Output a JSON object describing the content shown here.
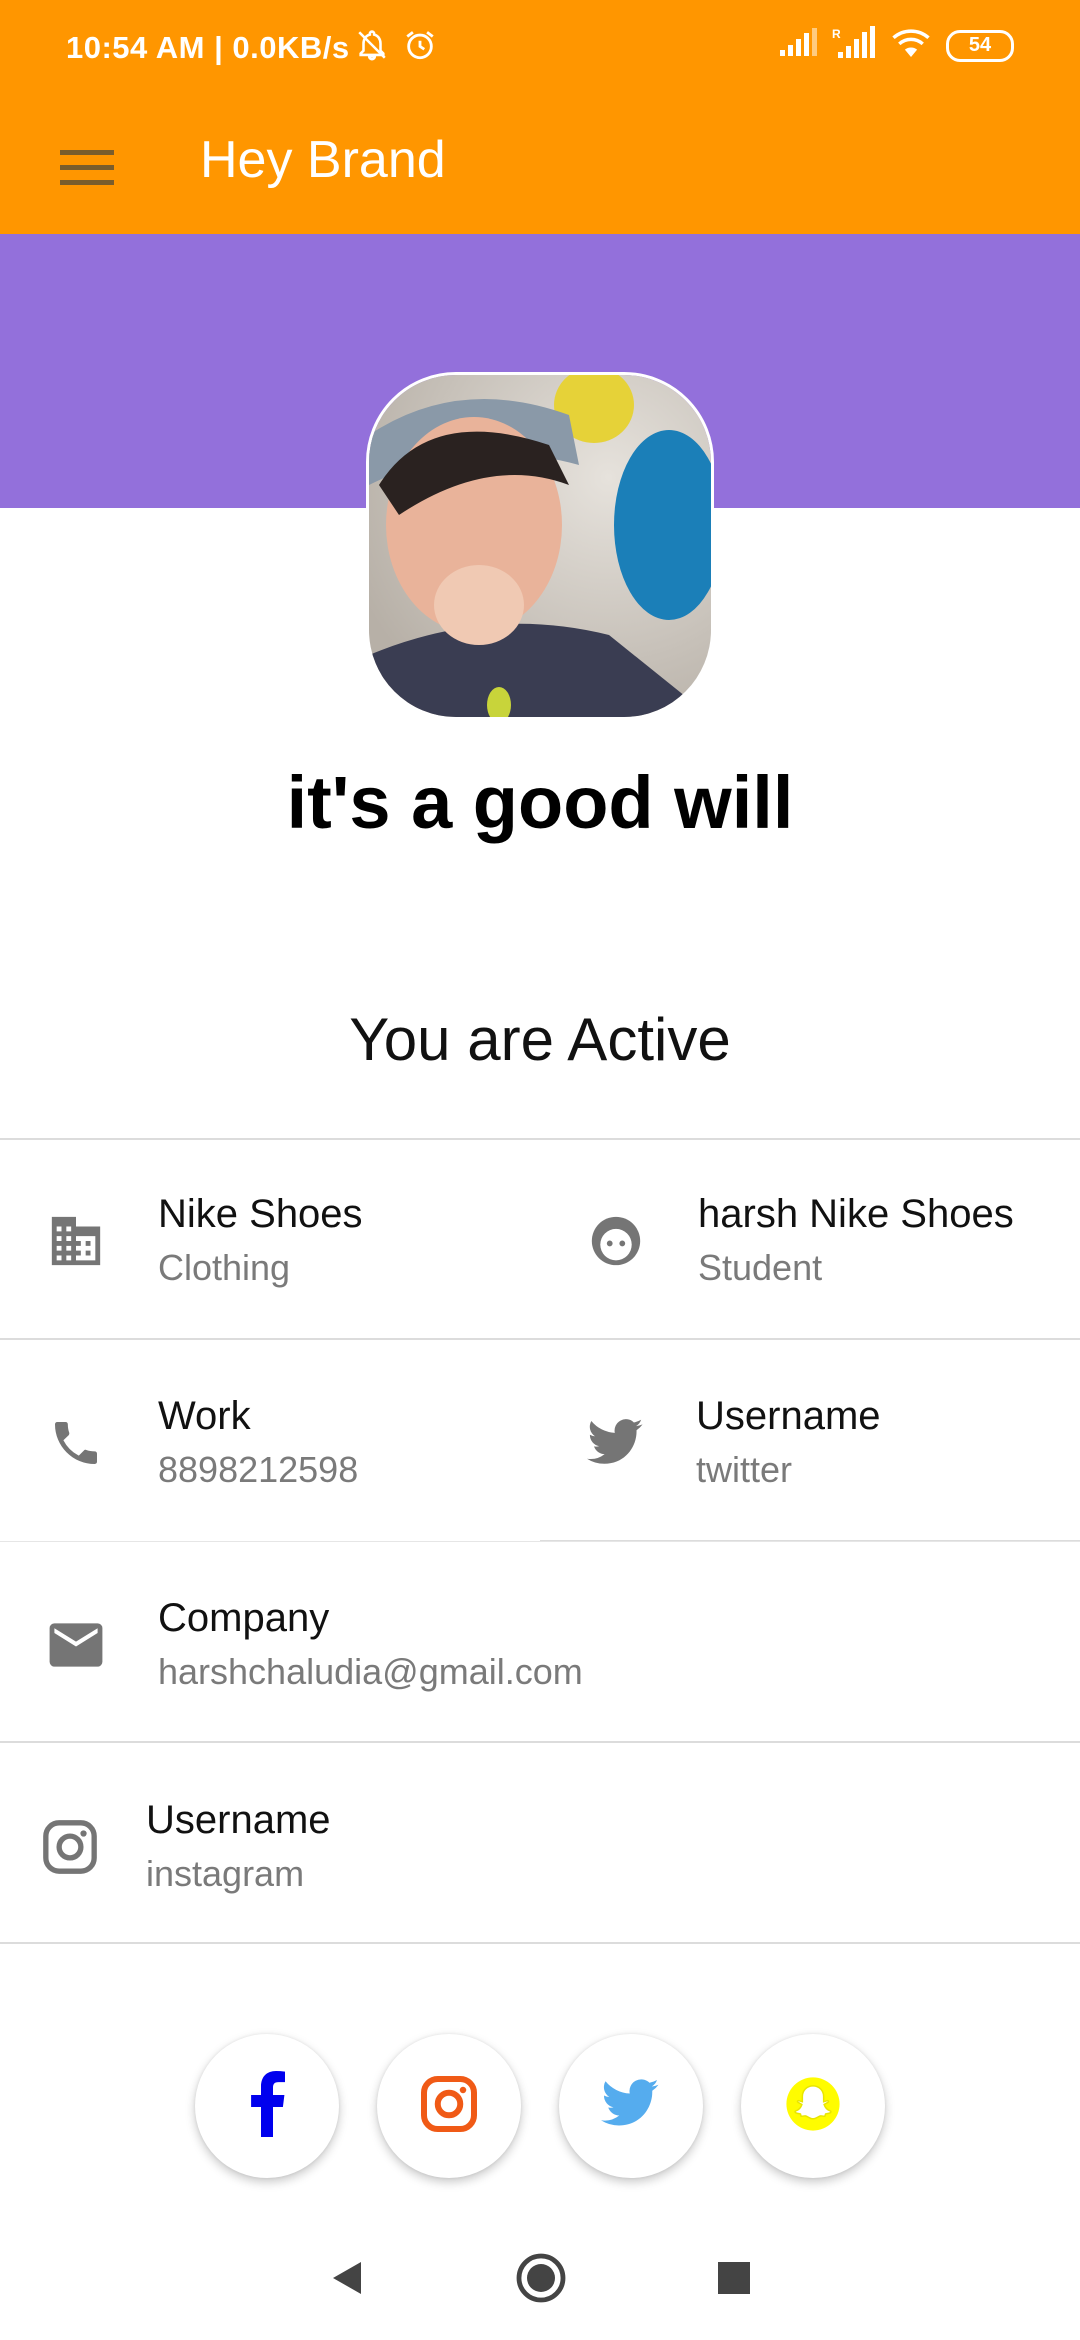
{
  "status_bar": {
    "time": "10:54 AM | 0.0KB/s",
    "battery": "54",
    "icons": [
      "bell-off-icon",
      "alarm-icon",
      "signal-icon",
      "signal-roaming-icon",
      "wifi-icon",
      "battery-icon"
    ]
  },
  "app_bar": {
    "title": "Hey Brand",
    "menu_icon": "hamburger-menu-icon"
  },
  "colors": {
    "app_bar": "#FF9600",
    "banner": "#9370DB",
    "icon_gray": "#757575",
    "facebook": "#0000EE",
    "instagram": "#F05A16",
    "twitter": "#55ACEE",
    "snapchat": "#FFFC00"
  },
  "profile": {
    "name": "it's a good will",
    "status": "You are Active"
  },
  "info": {
    "business": {
      "title": "Nike Shoes",
      "subtitle": "Clothing",
      "icon": "building-icon"
    },
    "owner": {
      "title": "harsh Nike Shoes",
      "subtitle": "Student",
      "icon": "face-icon"
    },
    "phone": {
      "title": "Work",
      "subtitle": "8898212598",
      "icon": "phone-icon"
    },
    "twitter": {
      "title": "Username",
      "subtitle": "twitter",
      "icon": "twitter-icon"
    },
    "email": {
      "title": "Company",
      "subtitle": "harshchaludia@gmail.com",
      "icon": "mail-icon"
    },
    "instagram": {
      "title": "Username",
      "subtitle": "instagram",
      "icon": "instagram-icon"
    }
  },
  "social_buttons": [
    "facebook-icon",
    "instagram-icon",
    "twitter-icon",
    "snapchat-icon"
  ],
  "nav_bar": [
    "back-icon",
    "home-icon",
    "recents-icon"
  ]
}
